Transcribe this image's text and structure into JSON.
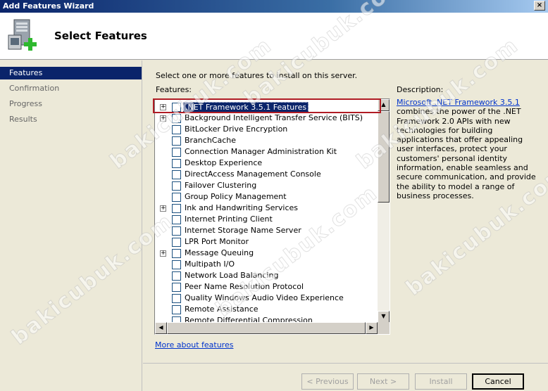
{
  "window": {
    "title": "Add Features Wizard",
    "close_glyph": "×"
  },
  "header": {
    "page_title": "Select Features"
  },
  "nav": {
    "items": [
      {
        "label": "Features",
        "active": true
      },
      {
        "label": "Confirmation",
        "active": false
      },
      {
        "label": "Progress",
        "active": false
      },
      {
        "label": "Results",
        "active": false
      }
    ]
  },
  "main": {
    "instruction": "Select one or more features to install on this server.",
    "features_label": "Features:",
    "description_label": "Description:",
    "description_link": "Microsoft .NET Framework 3.5.1",
    "description_text": "combines the power of the .NET Framework 2.0 APIs with new technologies for building applications that offer appealing user interfaces, protect your customers' personal identity information, enable seamless and secure communication, and provide the ability to model a range of business processes.",
    "more_link": "More about features"
  },
  "features": [
    {
      "label": ".NET Framework 3.5.1 Features",
      "expandable": true,
      "selected": true
    },
    {
      "label": "Background Intelligent Transfer Service (BITS)",
      "expandable": true,
      "selected": false
    },
    {
      "label": "BitLocker Drive Encryption",
      "expandable": false,
      "selected": false
    },
    {
      "label": "BranchCache",
      "expandable": false,
      "selected": false
    },
    {
      "label": "Connection Manager Administration Kit",
      "expandable": false,
      "selected": false
    },
    {
      "label": "Desktop Experience",
      "expandable": false,
      "selected": false
    },
    {
      "label": "DirectAccess Management Console",
      "expandable": false,
      "selected": false
    },
    {
      "label": "Failover Clustering",
      "expandable": false,
      "selected": false
    },
    {
      "label": "Group Policy Management",
      "expandable": false,
      "selected": false
    },
    {
      "label": "Ink and Handwriting Services",
      "expandable": true,
      "selected": false
    },
    {
      "label": "Internet Printing Client",
      "expandable": false,
      "selected": false
    },
    {
      "label": "Internet Storage Name Server",
      "expandable": false,
      "selected": false
    },
    {
      "label": "LPR Port Monitor",
      "expandable": false,
      "selected": false
    },
    {
      "label": "Message Queuing",
      "expandable": true,
      "selected": false
    },
    {
      "label": "Multipath I/O",
      "expandable": false,
      "selected": false
    },
    {
      "label": "Network Load Balancing",
      "expandable": false,
      "selected": false
    },
    {
      "label": "Peer Name Resolution Protocol",
      "expandable": false,
      "selected": false
    },
    {
      "label": "Quality Windows Audio Video Experience",
      "expandable": false,
      "selected": false
    },
    {
      "label": "Remote Assistance",
      "expandable": false,
      "selected": false
    },
    {
      "label": "Remote Differential Compression",
      "expandable": false,
      "selected": false
    }
  ],
  "buttons": {
    "previous": "< Previous",
    "next": "Next >",
    "install": "Install",
    "cancel": "Cancel"
  },
  "watermark": "bakicubuk.com",
  "colors": {
    "accent": "#0a246a",
    "highlight_box": "#b01c24",
    "link": "#0033cc"
  }
}
